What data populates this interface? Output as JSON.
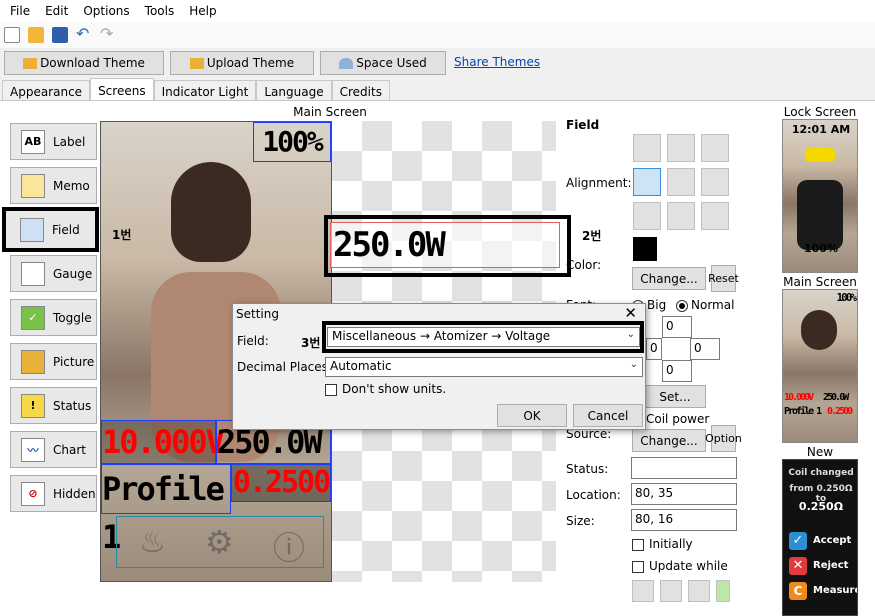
{
  "menu": [
    "File",
    "Edit",
    "Options",
    "Tools",
    "Help"
  ],
  "buttons": {
    "download_theme": "Download Theme",
    "upload_theme": "Upload Theme",
    "space_used": "Space Used",
    "share_themes": "Share Themes"
  },
  "tabs": [
    "Appearance",
    "Screens",
    "Indicator Light",
    "Language",
    "Credits"
  ],
  "sidebar": [
    "Label",
    "Memo",
    "Field",
    "Gauge",
    "Toggle",
    "Picture",
    "Status",
    "Chart",
    "Hidden"
  ],
  "main_screen": {
    "title": "Main Screen",
    "battery": "100%",
    "power": "250.0W",
    "voltage": "10.000V",
    "power_small": "250.0W",
    "profile": "Profile 1",
    "resistance": "0.2500",
    "marker_1": "1번",
    "marker_2": "2번",
    "marker_3": "3번"
  },
  "field_panel": {
    "title": "Field",
    "alignment": "Alignment:",
    "color": "Color:",
    "change": "Change...",
    "reset": "Reset",
    "font": "Font:",
    "big": "Big",
    "normal": "Normal",
    "margin_top": "0",
    "margin_left": "0",
    "margin_right": "0",
    "margin_bottom": "0",
    "set": "Set...",
    "coil_power": "Coil power",
    "source": "Source:",
    "change2": "Change...",
    "option": "Option",
    "status": "Status:",
    "status_value": "",
    "location": "Location:",
    "location_value": "80, 35",
    "size": "Size:",
    "size_value": "80, 16",
    "initially": "Initially",
    "update_while": "Update while"
  },
  "previews": {
    "lock_screen": "Lock Screen",
    "lock_time": "12:01 AM",
    "lock_battery": "100%",
    "main_screen": "Main Screen",
    "main_battery": "100%",
    "main_voltage": "10.000V",
    "main_power": "250.0W",
    "main_profile": "Profile 1",
    "main_res": "0.2500",
    "new_atomizer": "New Atomizer",
    "coil_msg_1": "Coil changed",
    "coil_msg_2": "from 0.250Ω to",
    "coil_msg_3": "0.250Ω",
    "accept": "Accept",
    "reject": "Reject",
    "measure": "Measure"
  },
  "dialog": {
    "title": "Setting",
    "field_label": "Field:",
    "field_value": "Miscellaneous → Atomizer → Voltage",
    "decimal_label": "Decimal Places:",
    "decimal_value": "Automatic",
    "dont_show_units": "Don't show units.",
    "ok": "OK",
    "cancel": "Cancel"
  },
  "colors": {
    "field_color": "#000000",
    "voltage_red": "#ff0000",
    "selection_blue": "#1e3cff"
  }
}
